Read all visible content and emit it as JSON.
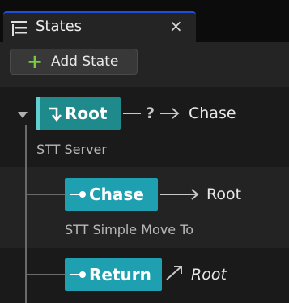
{
  "tab": {
    "title": "States",
    "close_glyph": "×",
    "icon": "outline-list-icon"
  },
  "toolbar": {
    "add_state_label": "Add State",
    "add_icon": "plus-icon"
  },
  "states": [
    {
      "name": "Root",
      "task": "STT Server",
      "transition_symbol": "?",
      "transition_target": "Chase",
      "color": "#1f8a8c"
    },
    {
      "name": "Chase",
      "task": "STT Simple Move To",
      "transition_target": "Root",
      "color": "#1ea0b0"
    },
    {
      "name": "Return",
      "transition_target": "Root",
      "color": "#1ea0b0"
    }
  ]
}
